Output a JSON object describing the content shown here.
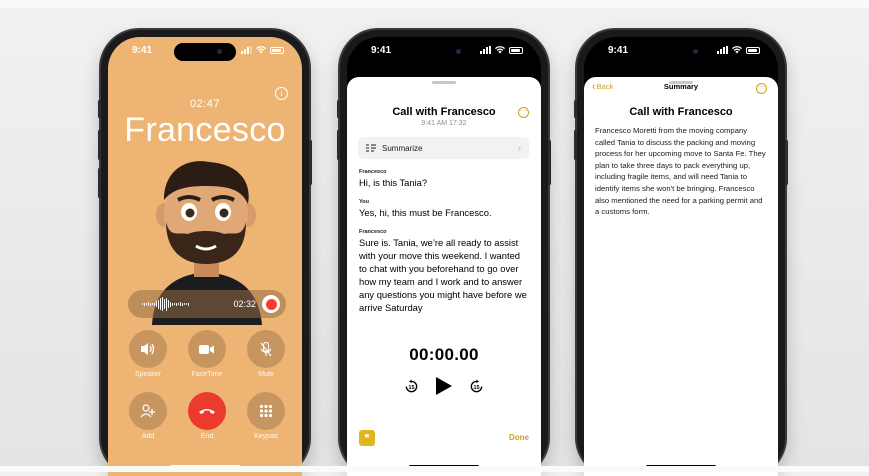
{
  "status_time": "9:41",
  "call_screen": {
    "duration": "02:47",
    "caller_name": "Francesco",
    "info_icon": "info-icon",
    "recording_time": "02:32",
    "controls": [
      {
        "label": "Speaker",
        "icon": "speaker-icon"
      },
      {
        "label": "FaceTime",
        "icon": "video-icon"
      },
      {
        "label": "Mute",
        "icon": "mic-slash-icon"
      },
      {
        "label": "Add",
        "icon": "add-person-icon"
      },
      {
        "label": "End",
        "icon": "end-call-icon"
      },
      {
        "label": "Keypad",
        "icon": "keypad-icon"
      }
    ],
    "colors": {
      "background": "#eeb474",
      "end_button": "#eb3b2f",
      "record_dot": "#ff3b30"
    }
  },
  "transcript_screen": {
    "title": "Call with Francesco",
    "date": "9:41 AM  17:32",
    "summarize_label": "Summarize",
    "entries": [
      {
        "speaker": "Francesco",
        "text": "Hi, is this Tania?"
      },
      {
        "speaker": "You",
        "text": "Yes, hi, this must be Francesco."
      },
      {
        "speaker": "Francesco",
        "text": "Sure is. Tania, we’re all ready to assist with your move this weekend. I wanted to chat with you beforehand to go over how my team and I work and to answer any questions you might have before we arrive Saturday"
      }
    ],
    "timer": "00:00.00",
    "skip_back_label": "15",
    "skip_forward_label": "15",
    "done_label": "Done",
    "accent_color": "#c9a227"
  },
  "summary_screen": {
    "back_label": "Back",
    "nav_title": "Summary",
    "title": "Call with Francesco",
    "body": "Francesco Moretti from the moving company called Tania to discuss the packing and moving process for her upcoming move to Santa Fe. They plan to take three days to pack everything up, including fragile items, and will need Tania to identify items she won't be bringing. Francesco also mentioned the need for a parking permit and a customs form."
  }
}
